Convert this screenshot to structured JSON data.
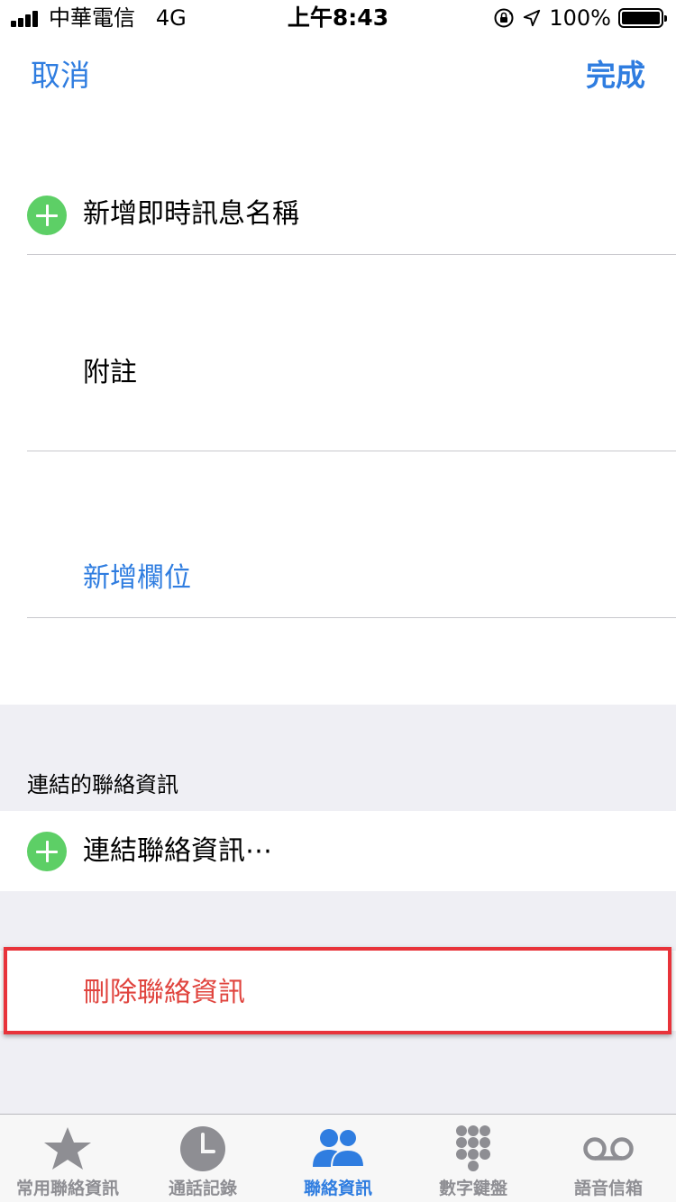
{
  "status_bar": {
    "carrier": "中華電信",
    "network": "4G",
    "time": "上午8:43",
    "battery": "100%"
  },
  "nav": {
    "cancel_label": "取消",
    "done_label": "完成"
  },
  "rows": {
    "add_im_label": "新增即時訊息名稱",
    "notes_label": "附註",
    "add_field_label": "新增欄位"
  },
  "linked": {
    "header": "連結的聯絡資訊",
    "link_label": "連結聯絡資訊⋯"
  },
  "delete_label": "刪除聯絡資訊",
  "tabs": [
    {
      "label": "常用聯絡資訊",
      "icon": "star-icon",
      "active": false
    },
    {
      "label": "通話記錄",
      "icon": "clock-icon",
      "active": false
    },
    {
      "label": "聯絡資訊",
      "icon": "contacts-icon",
      "active": true
    },
    {
      "label": "數字鍵盤",
      "icon": "keypad-icon",
      "active": false
    },
    {
      "label": "語音信箱",
      "icon": "voicemail-icon",
      "active": false
    }
  ],
  "colors": {
    "accent": "#2f7de0",
    "destructive": "#e0443e",
    "add_green": "#5dcf66",
    "group_background": "#efeff4",
    "highlight": "#e8333a"
  }
}
